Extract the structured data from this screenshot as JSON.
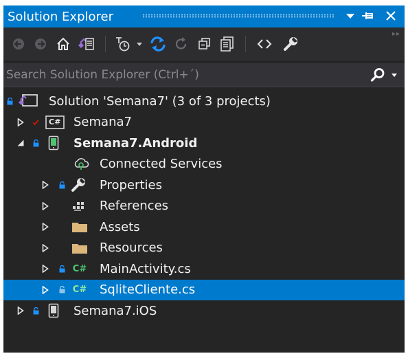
{
  "window": {
    "title": "Solution Explorer"
  },
  "search": {
    "placeholder": "Search Solution Explorer (Ctrl+´)"
  },
  "tree": {
    "solution": "Solution 'Semana7' (3 of 3 projects)",
    "semana7": "Semana7",
    "android": "Semana7.Android",
    "connected": "Connected Services",
    "properties": "Properties",
    "references": "References",
    "assets": "Assets",
    "resources": "Resources",
    "mainactivity": "MainActivity.cs",
    "sqlitecliente": "SqliteCliente.cs",
    "ios": "Semana7.iOS",
    "cs_badge": "C#"
  },
  "colors": {
    "accent": "#007acc",
    "panel": "#252526",
    "toolbar": "#2d2d30",
    "folder": "#dcb67a",
    "csharp": "#4ec56e"
  }
}
